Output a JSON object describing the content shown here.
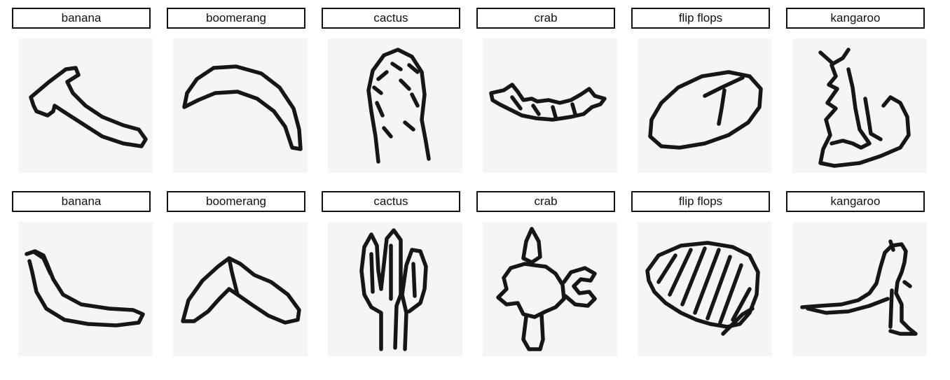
{
  "rows": [
    [
      {
        "label": "banana",
        "icon": "banana-sketch"
      },
      {
        "label": "boomerang",
        "icon": "boomerang-sketch"
      },
      {
        "label": "cactus",
        "icon": "cactus-sketch"
      },
      {
        "label": "crab",
        "icon": "crab-sketch"
      },
      {
        "label": "flip flops",
        "icon": "flip-flops-sketch"
      },
      {
        "label": "kangaroo",
        "icon": "kangaroo-sketch"
      }
    ],
    [
      {
        "label": "banana",
        "icon": "banana-sketch"
      },
      {
        "label": "boomerang",
        "icon": "boomerang-sketch"
      },
      {
        "label": "cactus",
        "icon": "cactus-sketch"
      },
      {
        "label": "crab",
        "icon": "crab-sketch"
      },
      {
        "label": "flip flops",
        "icon": "flip-flops-sketch"
      },
      {
        "label": "kangaroo",
        "icon": "kangaroo-sketch"
      }
    ]
  ]
}
